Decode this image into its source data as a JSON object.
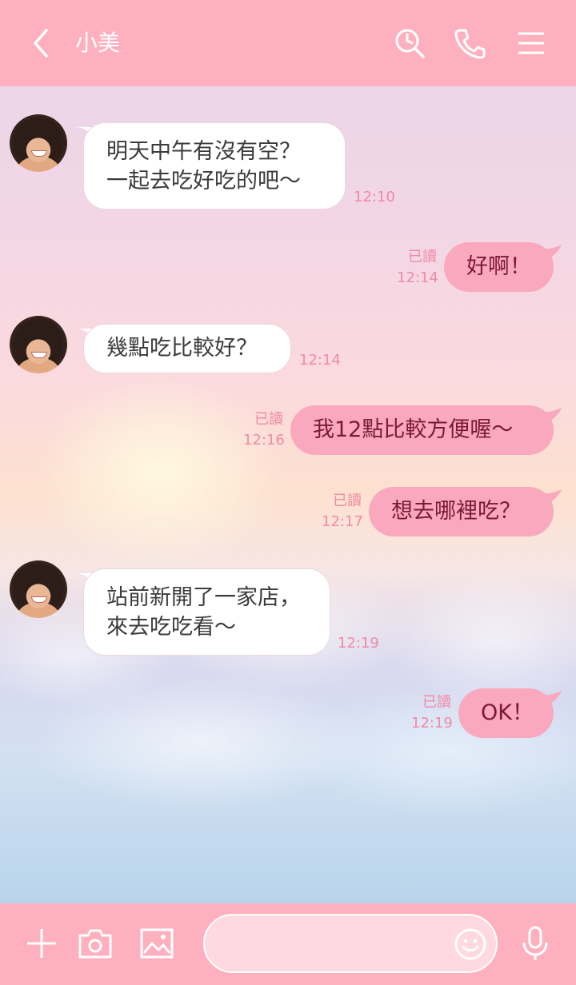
{
  "header": {
    "title": "小美",
    "back_icon": "chevron-left-icon",
    "search_icon": "search-clock-icon",
    "call_icon": "phone-icon",
    "menu_icon": "hamburger-menu-icon"
  },
  "messages": [
    {
      "side": "received",
      "text": "明天中午有沒有空？\n一起去吃好吃的吧〜",
      "time": "12:10"
    },
    {
      "side": "sent",
      "text": "好啊！",
      "read": "已讀",
      "time": "12:14"
    },
    {
      "side": "received",
      "text": "幾點吃比較好？",
      "time": "12:14"
    },
    {
      "side": "sent",
      "text": "我12點比較方便喔〜",
      "read": "已讀",
      "time": "12:16"
    },
    {
      "side": "sent",
      "text": "想去哪裡吃？",
      "read": "已讀",
      "time": "12:17"
    },
    {
      "side": "received",
      "text": "站前新開了一家店，\n來去吃吃看〜",
      "time": "12:19"
    },
    {
      "side": "sent",
      "text": "OK！",
      "read": "已讀",
      "time": "12:19"
    }
  ],
  "composer": {
    "placeholder": "",
    "plus_icon": "plus-icon",
    "camera_icon": "camera-icon",
    "image_icon": "image-icon",
    "emoji_icon": "emoji-icon",
    "mic_icon": "microphone-icon"
  },
  "colors": {
    "bar": "#ffb0bf",
    "sent_bubble": "#f9a8bd",
    "sent_text": "#7c1838",
    "time_text": "#f08aa5"
  }
}
